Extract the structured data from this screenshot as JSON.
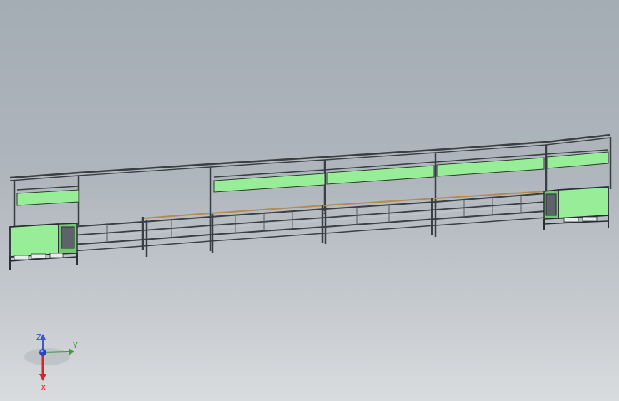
{
  "viewport": {
    "background_top": "#a4acb4",
    "background_bottom": "#d9dcde"
  },
  "model": {
    "frame_color": "#3a3f44",
    "panel_color": "#98ee98",
    "panel_dark": "#73c873",
    "rail_color": "#b9bec2",
    "roller_color": "#b48a52",
    "shadow_color": "#2a2e33"
  },
  "triad": {
    "z_label": "Z",
    "y_label": "Y",
    "x_label": "X",
    "z_color": "#3d56d6",
    "y_color": "#3a9c3a",
    "x_color": "#d82424"
  }
}
